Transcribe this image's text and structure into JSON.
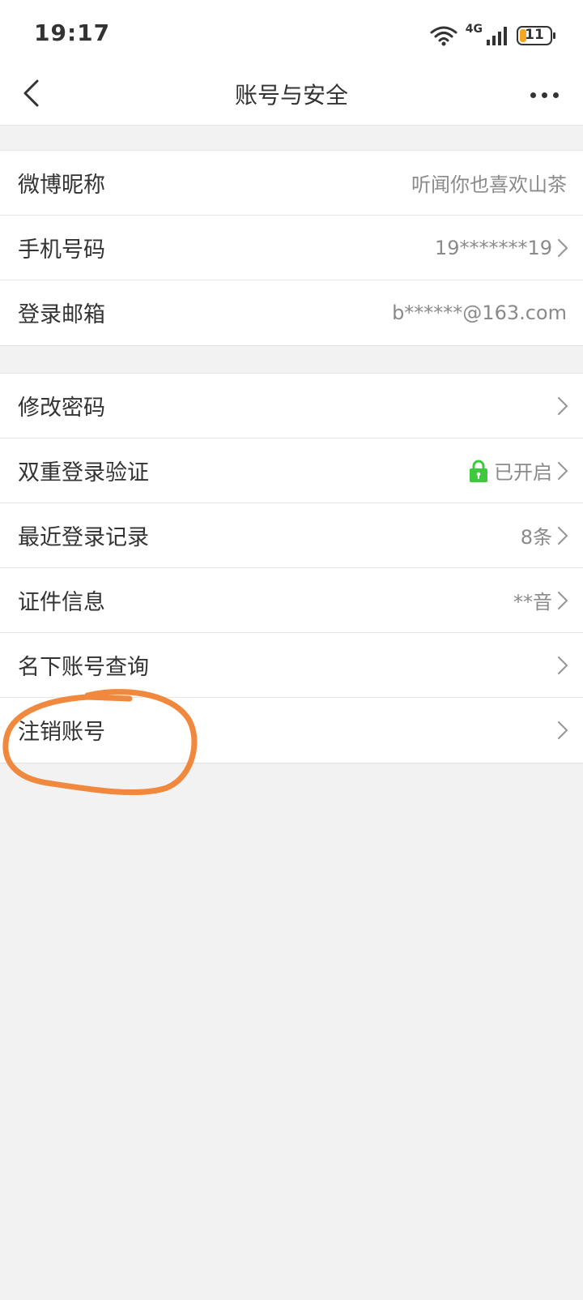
{
  "status_bar": {
    "time": "19:17",
    "network": "4G",
    "battery_level": "11",
    "icons": [
      "wifi-icon",
      "signal-icon",
      "battery-icon"
    ]
  },
  "nav": {
    "title": "账号与安全",
    "back_icon": "chevron-left-icon",
    "more_icon": "more-horizontal-icon"
  },
  "group_1": [
    {
      "label": "微博昵称",
      "value": "听闻你也喜欢山茶",
      "chevron": false
    },
    {
      "label": "手机号码",
      "value": "19*******19",
      "chevron": true
    },
    {
      "label": "登录邮箱",
      "value": "b******@163.com",
      "chevron": false
    }
  ],
  "group_2": [
    {
      "label": "修改密码",
      "value": "",
      "chevron": true
    },
    {
      "label": "双重登录验证",
      "value": "已开启",
      "chevron": true,
      "icon": "lock-icon"
    },
    {
      "label": "最近登录记录",
      "value": "8条",
      "chevron": true
    },
    {
      "label": "证件信息",
      "value": "**音",
      "chevron": true
    },
    {
      "label": "名下账号查询",
      "value": "",
      "chevron": true
    },
    {
      "label": "注销账号",
      "value": "",
      "chevron": true
    }
  ],
  "colors": {
    "accent_lock": "#3ec93e",
    "annotation": "#f0883e",
    "background": "#f2f2f2",
    "value_text": "#8a8a8a"
  }
}
